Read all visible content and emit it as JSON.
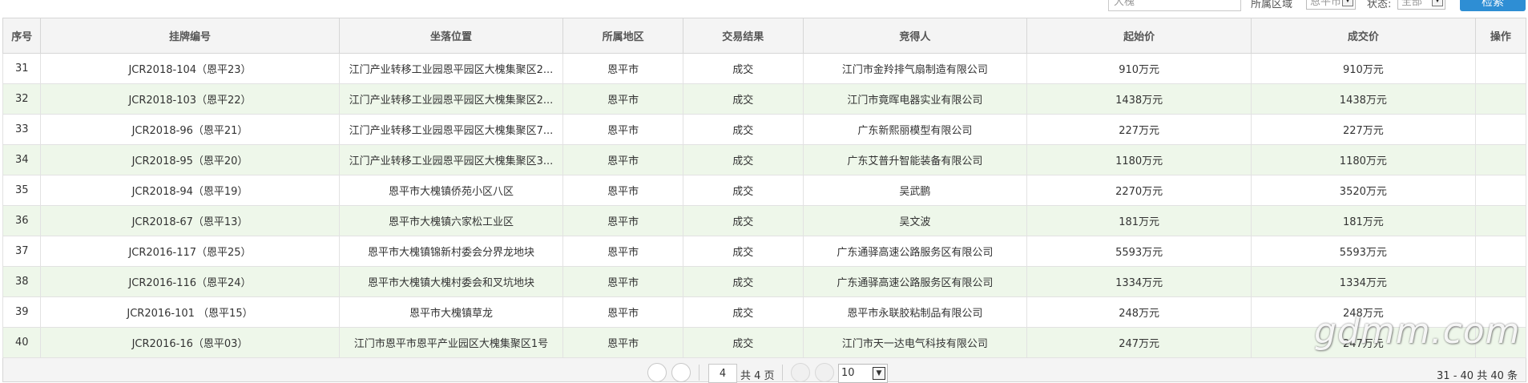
{
  "filters": {
    "keyword_value": "大槐",
    "district_label": "所属区域",
    "district_value": "恩平市",
    "status_label": "状态:",
    "status_value": "全部",
    "search_label": "检索"
  },
  "table": {
    "headers": [
      "序号",
      "挂牌编号",
      "坐落位置",
      "所属地区",
      "交易结果",
      "竞得人",
      "起始价",
      "成交价",
      "操作"
    ],
    "rows": [
      {
        "no": "31",
        "code": "JCR2018-104（恩平23）",
        "location": "江门产业转移工业园恩平园区大槐集聚区2...",
        "area": "恩平市",
        "result": "成交",
        "winner": "江门市金羚排气扇制造有限公司",
        "start": "910万元",
        "deal": "910万元"
      },
      {
        "no": "32",
        "code": "JCR2018-103（恩平22）",
        "location": "江门产业转移工业园恩平园区大槐集聚区2...",
        "area": "恩平市",
        "result": "成交",
        "winner": "江门市竟晖电器实业有限公司",
        "start": "1438万元",
        "deal": "1438万元"
      },
      {
        "no": "33",
        "code": "JCR2018-96（恩平21）",
        "location": "江门产业转移工业园恩平园区大槐集聚区7...",
        "area": "恩平市",
        "result": "成交",
        "winner": "广东新熙丽模型有限公司",
        "start": "227万元",
        "deal": "227万元"
      },
      {
        "no": "34",
        "code": "JCR2018-95（恩平20）",
        "location": "江门产业转移工业园恩平园区大槐集聚区3...",
        "area": "恩平市",
        "result": "成交",
        "winner": "广东艾普升智能装备有限公司",
        "start": "1180万元",
        "deal": "1180万元"
      },
      {
        "no": "35",
        "code": "JCR2018-94（恩平19）",
        "location": "恩平市大槐镇侨苑小区八区",
        "area": "恩平市",
        "result": "成交",
        "winner": "吴武鹏",
        "start": "2270万元",
        "deal": "3520万元"
      },
      {
        "no": "36",
        "code": "JCR2018-67（恩平13）",
        "location": "恩平市大槐镇六家松工业区",
        "area": "恩平市",
        "result": "成交",
        "winner": "吴文波",
        "start": "181万元",
        "deal": "181万元"
      },
      {
        "no": "37",
        "code": "JCR2016-117（恩平25）",
        "location": "恩平市大槐镇锦新村委会分界龙地块",
        "area": "恩平市",
        "result": "成交",
        "winner": "广东通驿高速公路服务区有限公司",
        "start": "5593万元",
        "deal": "5593万元"
      },
      {
        "no": "38",
        "code": "JCR2016-116（恩平24）",
        "location": "恩平市大槐镇大槐村委会和叉坑地块",
        "area": "恩平市",
        "result": "成交",
        "winner": "广东通驿高速公路服务区有限公司",
        "start": "1334万元",
        "deal": "1334万元"
      },
      {
        "no": "39",
        "code": "JCR2016-101 （恩平15）",
        "location": "恩平市大槐镇草龙",
        "area": "恩平市",
        "result": "成交",
        "winner": "恩平市永联胶粘制品有限公司",
        "start": "248万元",
        "deal": "248万元"
      },
      {
        "no": "40",
        "code": "JCR2016-16（恩平03）",
        "location": "江门市恩平市恩平产业园区大槐集聚区1号",
        "area": "恩平市",
        "result": "成交",
        "winner": "江门市天一达电气科技有限公司",
        "start": "247万元",
        "deal": "247万元"
      }
    ]
  },
  "pager": {
    "page_value": "4",
    "total_pages": "共 4 页",
    "page_size": "10",
    "range": "31 - 40  共 40 条"
  },
  "watermark": "gdmm.com"
}
